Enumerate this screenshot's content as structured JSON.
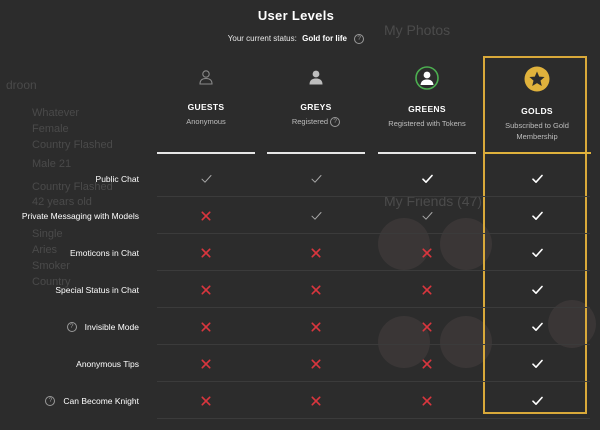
{
  "modal": {
    "title": "User Levels",
    "status_label": "Your current status:",
    "status_value": "Gold for life",
    "help_glyph": "?"
  },
  "columns": [
    {
      "id": "guests",
      "name": "GUESTS",
      "subtitle": "Anonymous",
      "icon": "user-outline-icon",
      "icon_color": "#8a8a8a"
    },
    {
      "id": "greys",
      "name": "GREYS",
      "subtitle": "Registered",
      "icon": "user-filled-icon",
      "icon_color": "#bdbdbd"
    },
    {
      "id": "greens",
      "name": "GREENS",
      "subtitle": "Registered with Tokens",
      "icon": "user-circle-icon",
      "icon_color": "#4caf50"
    },
    {
      "id": "golds",
      "name": "GOLDS",
      "subtitle": "Subscribed to Gold Membership",
      "icon": "star-icon",
      "icon_color": "#e0b23c"
    }
  ],
  "features": [
    {
      "label": "Public Chat",
      "help": false,
      "values": [
        "check-grey",
        "check-grey",
        "check",
        "check"
      ]
    },
    {
      "label": "Private Messaging with Models",
      "help": false,
      "values": [
        "cross",
        "check-grey",
        "check-grey",
        "check"
      ]
    },
    {
      "label": "Emoticons in Chat",
      "help": false,
      "values": [
        "cross",
        "cross",
        "cross",
        "check"
      ]
    },
    {
      "label": "Special Status in Chat",
      "help": false,
      "values": [
        "cross",
        "cross",
        "cross",
        "check"
      ]
    },
    {
      "label": "Invisible Mode",
      "help": true,
      "values": [
        "cross",
        "cross",
        "cross",
        "check"
      ]
    },
    {
      "label": "Anonymous Tips",
      "help": false,
      "values": [
        "cross",
        "cross",
        "cross",
        "check"
      ]
    },
    {
      "label": "Can Become Knight",
      "help": true,
      "values": [
        "cross",
        "cross",
        "cross",
        "check"
      ]
    }
  ],
  "colors": {
    "cross": "#d9363e",
    "check": "#ffffff",
    "check_grey": "#a8a8a8",
    "gold": "#e0b23c"
  },
  "background": {
    "my_photos": "My Photos",
    "my_friends": "My Friends (47)",
    "sidebar_items": [
      "Whatever",
      "Female",
      "Country Flashed",
      "Male 21",
      "Country Flashed",
      "42 years old",
      "Single",
      "Aries",
      "Smoker",
      "Country"
    ]
  }
}
